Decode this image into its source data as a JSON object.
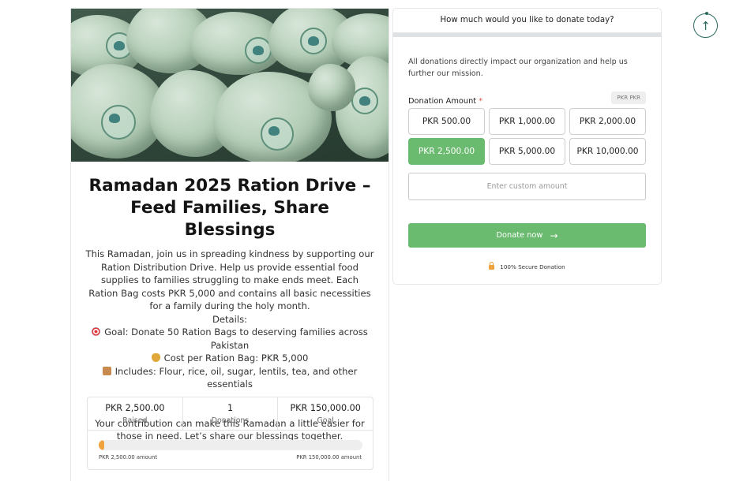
{
  "campaign": {
    "title": "Ramadan 2025 Ration Drive – Feed Families, Share Blessings",
    "description": "This Ramadan, join us in spreading kindness by supporting our Ration Distribution Drive. Help us provide essential food supplies to families struggling to make ends meet. Each Ration Bag costs PKR 5,000 and contains all basic necessities for a family during the holy month.",
    "details_label": "Details:",
    "goal_line": "Goal: Donate 50 Ration Bags to deserving families across Pakistan",
    "cost_line": "Cost per Ration Bag: PKR 5,000",
    "includes_line": "Includes: Flour, rice, oil, sugar, lentils, tea, and other essentials",
    "closing": "Your contribution can make this Ramadan a little easier for those in need. Let’s share our blessings together.",
    "bag_logo_text": "THE AMSH FOUNDATION"
  },
  "stats": {
    "raised_value": "PKR 2,500.00",
    "raised_label": "Raised",
    "donations_value": "1",
    "donations_label": "Donations",
    "goal_value": "PKR 150,000.00",
    "goal_label": "Goal",
    "progress_fraction": 0.0167,
    "progress_left": "PKR 2,500.00 amount",
    "progress_right": "PKR 150,000.00 amount",
    "progress_color": "#f0a23c"
  },
  "donate": {
    "header": "How much would you like to donate today?",
    "intro": "All donations directly impact our organization and help us further our mission.",
    "amount_label": "Donation Amount",
    "required_mark": "*",
    "currency_badge": "PKR  PKR",
    "amounts": [
      "PKR 500.00",
      "PKR 1,000.00",
      "PKR 2,000.00",
      "PKR 2,500.00",
      "PKR 5,000.00",
      "PKR 10,000.00"
    ],
    "selected_index": 3,
    "custom_placeholder": "Enter custom amount",
    "donate_label": "Donate now",
    "secure_label": "100% Secure Donation",
    "accent_color": "#6abb6f"
  },
  "icons": {
    "scroll_top": "↑",
    "donate_arrow": "→"
  }
}
